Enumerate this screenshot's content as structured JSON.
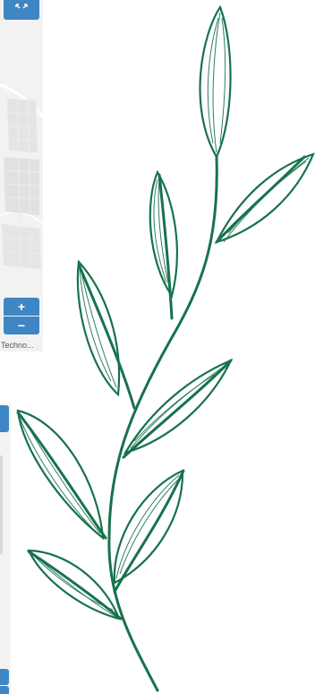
{
  "map_top": {
    "expand_icon": "expand-arrows-icon",
    "zoom_in_label": "+",
    "zoom_out_label": "−",
    "attribution": "Techno..."
  },
  "map_bottom": {
    "expand_icon": "expand-icon",
    "zoom_icon": "zoom-icon"
  },
  "decoration": {
    "name": "leafy-branch-illustration",
    "color": "#17724d"
  },
  "colors": {
    "control_blue": "#3f86c4",
    "map_background": "#f3f3f3"
  }
}
